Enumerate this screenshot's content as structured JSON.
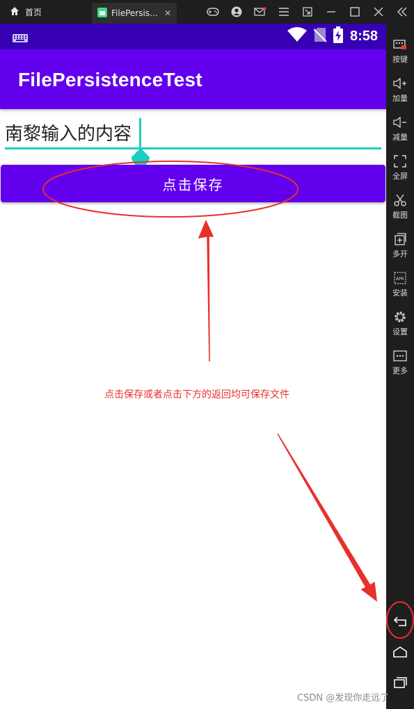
{
  "window": {
    "home_tab_label": "首页",
    "app_tab_label": "FilePersistenceTest",
    "app_tab_close": "✕"
  },
  "sidebar": {
    "items": [
      {
        "label": "按键",
        "icon": "keyboard-icon"
      },
      {
        "label": "加量",
        "icon": "volume-up-icon"
      },
      {
        "label": "减量",
        "icon": "volume-down-icon"
      },
      {
        "label": "全屏",
        "icon": "fullscreen-icon"
      },
      {
        "label": "截图",
        "icon": "scissors-icon"
      },
      {
        "label": "多开",
        "icon": "multi-open-icon"
      },
      {
        "label": "安装",
        "icon": "apk-icon"
      },
      {
        "label": "设置",
        "icon": "gear-icon"
      },
      {
        "label": "更多",
        "icon": "more-icon"
      }
    ]
  },
  "status_bar": {
    "time": "8:58"
  },
  "app_bar": {
    "title": "FilePersistenceTest"
  },
  "edit_text": {
    "value": "南黎输入的内容"
  },
  "save_button": {
    "label": "点击保存"
  },
  "annotation": {
    "text": "点击保存或者点击下方的返回均可保存文件"
  },
  "watermark": "CSDN @发现你走远了",
  "colors": {
    "status_bar": "#3700b3",
    "primary": "#6200ee",
    "accent": "#1ccfc0",
    "annotation_red": "#e8302a"
  }
}
